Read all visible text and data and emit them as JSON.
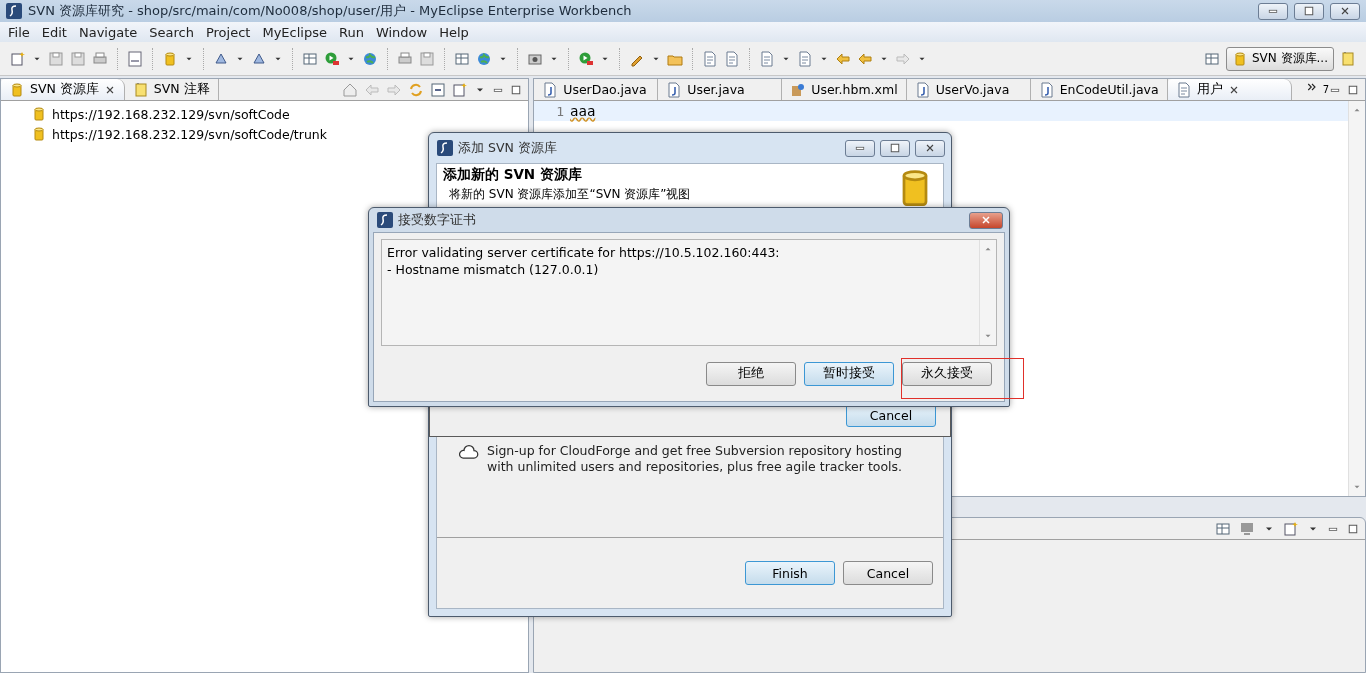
{
  "window": {
    "title": "SVN 资源库研究 - shop/src/main/com/No008/shop/user/用户 - MyEclipse Enterprise Workbench"
  },
  "menu": [
    "File",
    "Edit",
    "Navigate",
    "Search",
    "Project",
    "MyEclipse",
    "Run",
    "Window",
    "Help"
  ],
  "perspective": {
    "label": "SVN 资源库...",
    "selected": true
  },
  "left_panel": {
    "tabs": [
      {
        "label": "SVN 资源库",
        "selected": true
      },
      {
        "label": "SVN 注释",
        "selected": false
      }
    ],
    "repositories": [
      "https://192.168.232.129/svn/softCode",
      "https://192.168.232.129/svn/softCode/trunk"
    ]
  },
  "editor": {
    "tabs": [
      {
        "label": "UserDao.java",
        "kind": "java",
        "selected": false
      },
      {
        "label": "User.java",
        "kind": "java",
        "selected": false
      },
      {
        "label": "User.hbm.xml",
        "kind": "xml",
        "selected": false
      },
      {
        "label": "UserVo.java",
        "kind": "java",
        "selected": false
      },
      {
        "label": "EnCodeUtil.java",
        "kind": "java",
        "selected": false
      },
      {
        "label": "用户",
        "kind": "text",
        "selected": true
      }
    ],
    "hidden_tabs": "7",
    "lines": [
      {
        "number": "1",
        "text": "aaa"
      }
    ]
  },
  "svn_dialog": {
    "title": "添加 SVN 资源库",
    "heading": "添加新的 SVN 资源库",
    "description": "将新的 SVN 资源库添加至“SVN 资源库”视图",
    "inner_button": "Cancel",
    "promo": "Sign-up for CloudForge and get free Subversion repository hosting\nwith unlimited users and repositories, plus free agile tracker tools.",
    "buttons": [
      {
        "label": "Finish",
        "default": true
      },
      {
        "label": "Cancel",
        "default": false
      }
    ]
  },
  "cert_dialog": {
    "title": "接受数字证书",
    "message": "Error validating server certificate for https://10.5.102.160:443:\n - Hostname mismatch (127.0.0.1)",
    "buttons": [
      {
        "label": "拒绝",
        "focused": false,
        "highlighted": false
      },
      {
        "label": "暂时接受",
        "focused": true,
        "highlighted": false
      },
      {
        "label": "永久接受",
        "focused": false,
        "highlighted": true
      }
    ]
  }
}
